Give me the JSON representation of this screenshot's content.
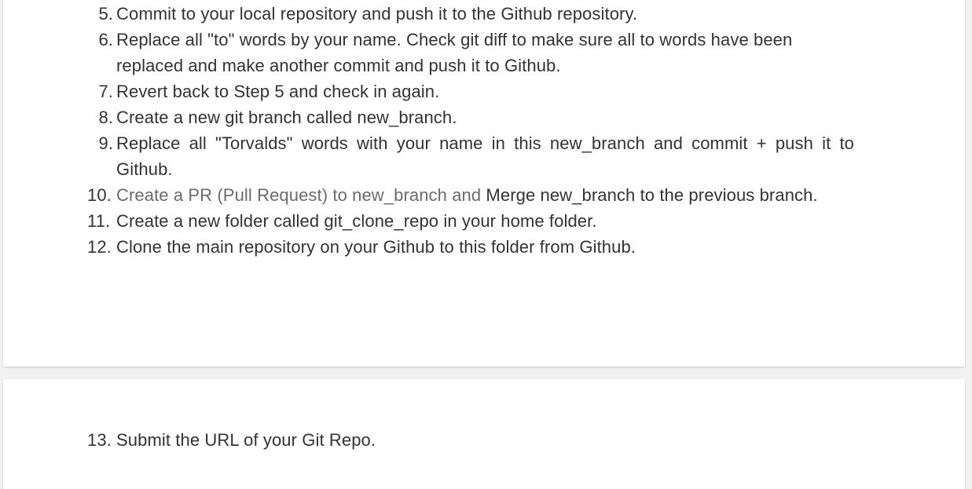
{
  "card_top": {
    "items": [
      {
        "number": "5.",
        "text": "Commit to your local repository and push it to the Github repository."
      },
      {
        "number": "6.",
        "text": "Replace all \"to\" words by your name. Check git diff to make sure all to words have been replaced and make another commit and push it to Github."
      },
      {
        "number": "7.",
        "text": "Revert back to Step 5 and check in again."
      },
      {
        "number": "8.",
        "text": "Create a new git branch called new_branch."
      },
      {
        "number": "9.",
        "text": "Replace all \"Torvalds\" words with your name in this new_branch and commit + push it to Github."
      },
      {
        "number": "10.",
        "text_muted": "Create a PR (Pull Request) to new_branch and",
        "text_rest": " Merge new_branch to the previous branch."
      },
      {
        "number": "11.",
        "text": "Create a new folder called git_clone_repo in your home folder."
      },
      {
        "number": "12.",
        "text": "Clone the main repository on your Github to this folder from Github."
      }
    ]
  },
  "card_bottom": {
    "items": [
      {
        "number": "13.",
        "text": "Submit the URL of your Git Repo."
      }
    ]
  },
  "colors": {
    "page_background": "#f1f1f1",
    "card_background": "#ffffff",
    "text": "#333333",
    "muted_text": "#6b6b6b"
  }
}
